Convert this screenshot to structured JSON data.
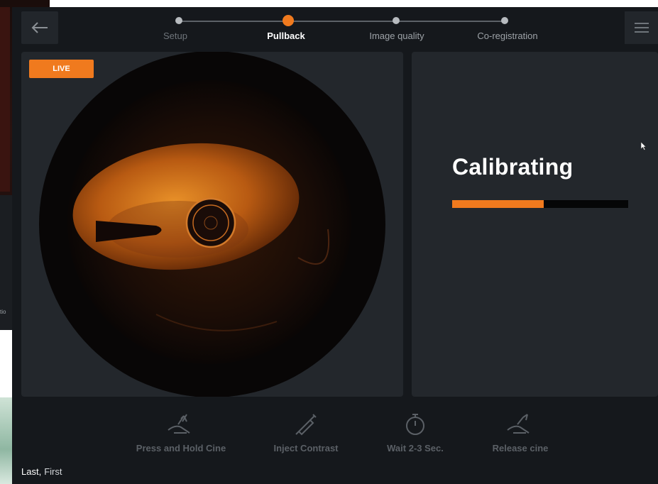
{
  "background": {
    "partial_text": "tio"
  },
  "header": {
    "steps": [
      {
        "label": "Setup",
        "state": "done"
      },
      {
        "label": "Pullback",
        "state": "active"
      },
      {
        "label": "Image quality",
        "state": "pending"
      },
      {
        "label": "Co-registration",
        "state": "pending"
      }
    ],
    "back_icon": "arrow-left-icon",
    "menu_icon": "hamburger-menu-icon"
  },
  "live_view": {
    "badge": "LIVE"
  },
  "calibration": {
    "title": "Calibrating",
    "progress": 0.52
  },
  "instructions": [
    {
      "label": "Press and Hold Cine",
      "icon": "hand-press-icon"
    },
    {
      "label": "Inject Contrast",
      "icon": "syringe-icon"
    },
    {
      "label": "Wait 2-3 Sec.",
      "icon": "stopwatch-icon"
    },
    {
      "label": "Release cine",
      "icon": "hand-release-icon"
    }
  ],
  "footer": {
    "first_word": "Last,",
    "second_word": "First"
  },
  "colors": {
    "accent": "#f07a1e",
    "panel": "#23272c",
    "background": "#15181c"
  }
}
